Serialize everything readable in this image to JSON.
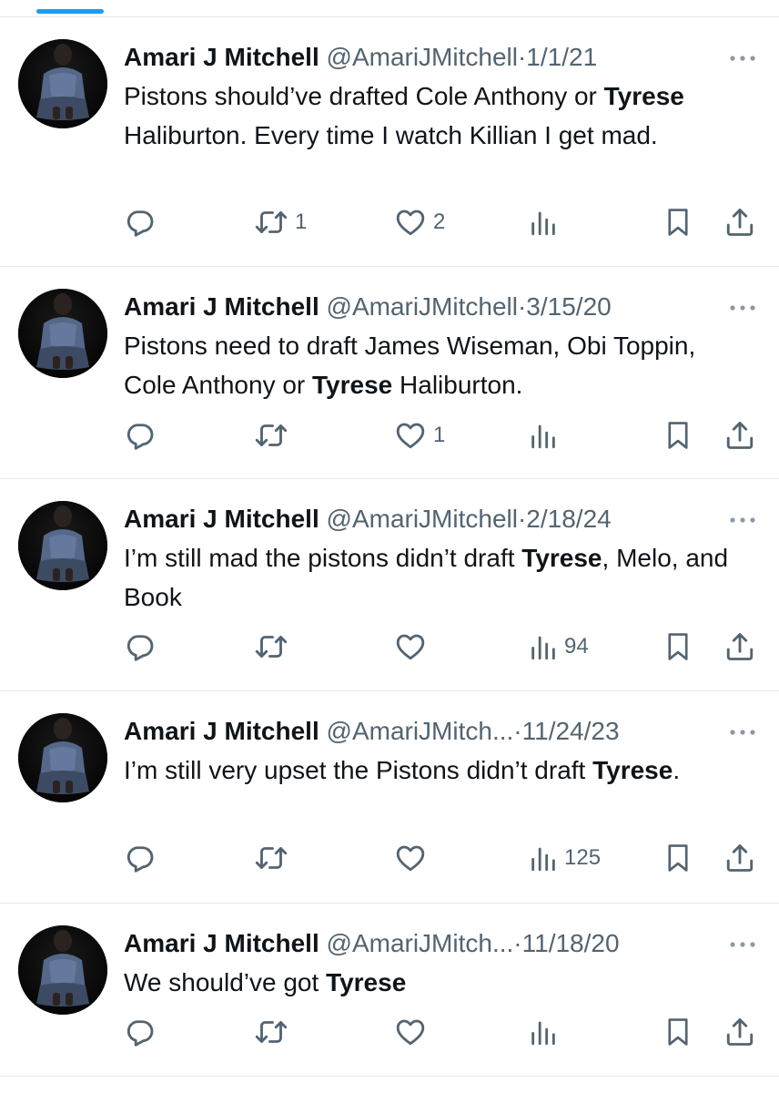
{
  "colors": {
    "accent": "#1d9bf0",
    "text": "#0f1419",
    "muted": "#536471",
    "divider": "#e6e9eb"
  },
  "icons": {
    "reply": "reply-icon",
    "retweet": "retweet-icon",
    "like": "heart-icon",
    "views": "views-icon",
    "bookmark": "bookmark-icon",
    "share": "share-icon",
    "more": "more-icon"
  },
  "tweets": [
    {
      "display_name": "Amari J Mitchell",
      "handle": "@AmariJMitchell",
      "separator": "·",
      "date": "1/1/21",
      "text_segments": [
        {
          "text": "Pistons should’ve drafted Cole Anthony or ",
          "bold": false
        },
        {
          "text": "Tyrese",
          "bold": true
        },
        {
          "text": " Haliburton. Every time I watch Killian I get mad.",
          "bold": false
        }
      ],
      "reply_count": "",
      "retweet_count": "1",
      "like_count": "2",
      "view_count": ""
    },
    {
      "display_name": "Amari J Mitchell",
      "handle": "@AmariJMitchell",
      "separator": "·",
      "date": "3/15/20",
      "text_segments": [
        {
          "text": "Pistons need to draft James Wiseman, Obi Toppin, Cole Anthony or ",
          "bold": false
        },
        {
          "text": "Tyrese",
          "bold": true
        },
        {
          "text": " Haliburton.",
          "bold": false
        }
      ],
      "reply_count": "",
      "retweet_count": "",
      "like_count": "1",
      "view_count": ""
    },
    {
      "display_name": "Amari J Mitchell",
      "handle": "@AmariJMitchell",
      "separator": "·",
      "date": "2/18/24",
      "text_segments": [
        {
          "text": "I’m still mad the pistons didn’t draft ",
          "bold": false
        },
        {
          "text": "Tyrese",
          "bold": true
        },
        {
          "text": ", Melo, and Book",
          "bold": false
        }
      ],
      "reply_count": "",
      "retweet_count": "",
      "like_count": "",
      "view_count": "94"
    },
    {
      "display_name": "Amari J Mitchell",
      "handle": "@AmariJMitch...",
      "separator": "·",
      "date": "11/24/23",
      "text_segments": [
        {
          "text": "I’m still very upset the Pistons didn’t draft ",
          "bold": false
        },
        {
          "text": "Tyrese",
          "bold": true
        },
        {
          "text": ".",
          "bold": false
        }
      ],
      "reply_count": "",
      "retweet_count": "",
      "like_count": "",
      "view_count": "125"
    },
    {
      "display_name": "Amari J Mitchell",
      "handle": "@AmariJMitch...",
      "separator": "·",
      "date": "11/18/20",
      "text_segments": [
        {
          "text": "We should’ve got ",
          "bold": false
        },
        {
          "text": "Tyrese",
          "bold": true
        }
      ],
      "reply_count": "",
      "retweet_count": "",
      "like_count": "",
      "view_count": ""
    }
  ]
}
